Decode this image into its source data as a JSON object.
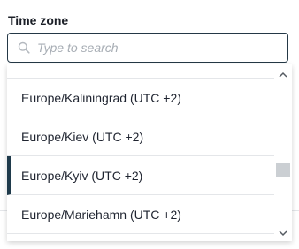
{
  "field": {
    "label": "Time zone",
    "search_placeholder": "Type to search",
    "search_value": ""
  },
  "options": [
    {
      "label": "Europe/Kaliningrad (UTC +2)",
      "selected": false
    },
    {
      "label": "Europe/Kiev (UTC +2)",
      "selected": false
    },
    {
      "label": "Europe/Kyiv (UTC +2)",
      "selected": true
    },
    {
      "label": "Europe/Mariehamn (UTC +2)",
      "selected": false
    }
  ],
  "icons": {
    "search": "search-icon",
    "scroll_up": "chevron-up-icon",
    "scroll_down": "chevron-down-icon"
  },
  "colors": {
    "border_focus": "#243846",
    "selected_indicator": "#1f3a4b",
    "placeholder": "#a7adb4"
  }
}
